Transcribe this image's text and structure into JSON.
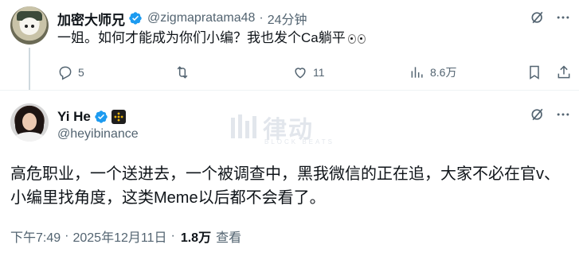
{
  "reply": {
    "name": "加密大师兄",
    "handle": "@zigmapratama48",
    "separator": "·",
    "time": "24分钟",
    "text": "一姐。如何才能成为你们小编？我也发个Ca躺平",
    "actions": {
      "reply_count": "5",
      "retweet_count": "",
      "like_count": "11",
      "view_count": "8.6万"
    }
  },
  "tweet": {
    "name": "Yi He",
    "handle": "@heyibinance",
    "text": "高危职业，一个送进去，一个被调查中，黑我微信的正在追，大家不必在官v、小编里找角度，这类Meme以后都不会看了。",
    "timestamp": "下午7:49",
    "separator": "·",
    "date": "2025年12月11日",
    "views": "1.8万",
    "views_label": "查看"
  },
  "watermark": {
    "brand": "律动",
    "sub": "BLOCK BEATS"
  },
  "colors": {
    "verified_blue": "#1d9bf0",
    "text_primary": "#0f1419",
    "text_secondary": "#536471",
    "divider": "#eff3f4",
    "binance_yellow": "#f0b90b"
  },
  "icons": [
    "verified-badge-icon",
    "grok-icon",
    "more-icon",
    "reply-icon",
    "retweet-icon",
    "like-icon",
    "views-icon",
    "bookmark-icon",
    "share-icon",
    "binance-badge-icon"
  ]
}
